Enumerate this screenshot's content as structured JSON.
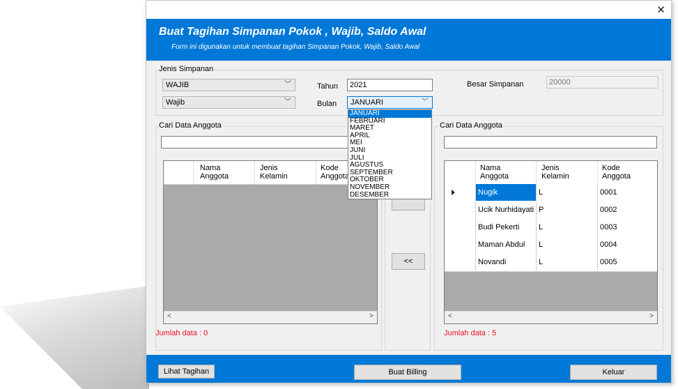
{
  "window": {
    "close_glyph": "✕"
  },
  "banner": {
    "title": "Buat Tagihan Simpanan Pokok , Wajib, Saldo Awal",
    "subtitle": "Form ini digunakan untuk membuat tagihan Simpanan Pokok, Wajib, Saldo Awal"
  },
  "jenis": {
    "group_label": "Jenis Simpanan",
    "combo1": "WAJIB",
    "combo2": "Wajib",
    "tahun_label": "Tahun",
    "tahun_value": "2021",
    "bulan_label": "Bulan",
    "bulan_value": "JANUARI",
    "besar_label": "Besar Simpanan",
    "besar_value": "20000",
    "months": [
      "JANUARI",
      "FEBRUARI",
      "MARET",
      "APRIL",
      "MEI",
      "JUNI",
      "JULI",
      "AGUSTUS",
      "SEPTEMBER",
      "OKTOBER",
      "NOVEMBER",
      "DESEMBER"
    ]
  },
  "left": {
    "group_label": "Cari Data Anggota",
    "search_value": "",
    "headers": [
      "Nama Anggota",
      "Jenis Kelamin",
      "Kode Anggota"
    ],
    "count": "Jumlah data : 0"
  },
  "middle": {
    "move_left": "<<"
  },
  "right": {
    "group_label": "Cari Data Anggota",
    "search_value": "",
    "headers": [
      "Nama Anggota",
      "Jenis Kelamin",
      "Kode Anggota"
    ],
    "rows": [
      [
        "Nugik",
        "L",
        "0001"
      ],
      [
        "Ucik Nurhidayati",
        "P",
        "0002"
      ],
      [
        "Budi Pekerti",
        "L",
        "0003"
      ],
      [
        "Maman Abdul",
        "L",
        "0004"
      ],
      [
        "Novandi",
        "L",
        "0005"
      ]
    ],
    "count": "Jumlah data : 5"
  },
  "footer": {
    "lihat": "Lihat Tagihan",
    "buat": "Buat Billing",
    "keluar": "Keluar"
  },
  "scroll": {
    "left_glyph": "<",
    "right_glyph": ">"
  },
  "colors": {
    "accent": "#0078d7",
    "error": "#e81123"
  }
}
